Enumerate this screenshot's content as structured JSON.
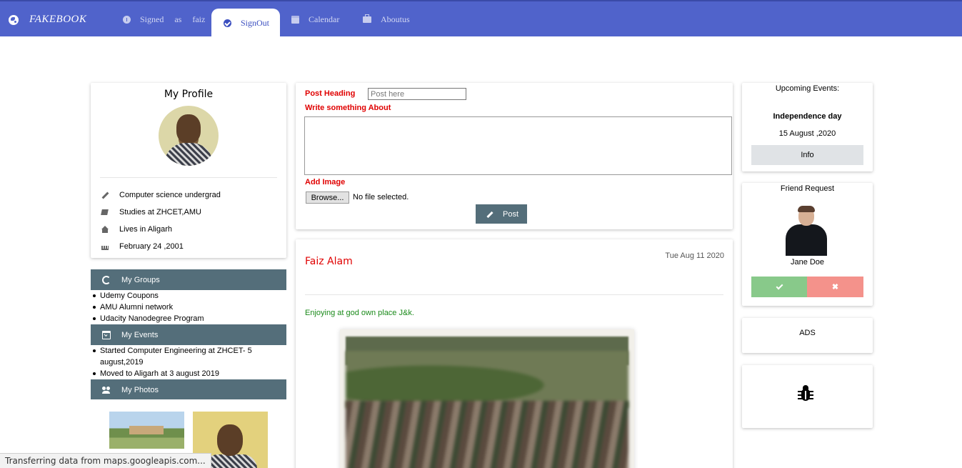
{
  "navbar": {
    "brand": "FAKEBOOK",
    "items": [
      {
        "label": "Signed   as   faiz"
      },
      {
        "label": "SignOut"
      },
      {
        "label": "Calendar"
      },
      {
        "label": "Aboutus"
      }
    ],
    "color": "#5063cb"
  },
  "profile": {
    "title": "My Profile",
    "info": [
      {
        "icon": "pencil-icon",
        "text": "Computer science undergrad"
      },
      {
        "icon": "book-icon",
        "text": "Studies at ZHCET,AMU"
      },
      {
        "icon": "home-icon",
        "text": "Lives in Aligarh"
      },
      {
        "icon": "birthday-cake-icon",
        "text": "February 24 ,2001"
      }
    ]
  },
  "groups": {
    "title": "My Groups",
    "items": [
      "Udemy Coupons",
      "AMU Alumni network",
      "Udacity Nanodegree Program"
    ]
  },
  "events_list": {
    "title": "My Events",
    "items": [
      "Started Computer Engineering at ZHCET- 5 august,2019",
      "Moved to Aligarh at 3 august 2019"
    ]
  },
  "photos": {
    "title": "My Photos"
  },
  "composer": {
    "heading_label": "Post Heading",
    "heading_placeholder": "Post here",
    "about_label": "Write something About",
    "image_label": "Add Image",
    "browse_label": "Browse...",
    "file_status": "No file selected.",
    "post_label": "Post"
  },
  "post": {
    "author": "Faiz Alam",
    "date": "Tue Aug 11 2020",
    "text": "Enjoying at god own place J&k."
  },
  "upcoming": {
    "title": "Upcoming Events:",
    "event_name": "Independence day",
    "event_date": "15 August ,2020",
    "info_label": "Info"
  },
  "friend_request": {
    "title": "Friend Request",
    "name": "Jane Doe",
    "accept_icon": "check-icon",
    "reject_label": "✖"
  },
  "ads": {
    "title": "ADS"
  },
  "statusbar": {
    "text": "Transferring data from maps.googleapis.com..."
  }
}
